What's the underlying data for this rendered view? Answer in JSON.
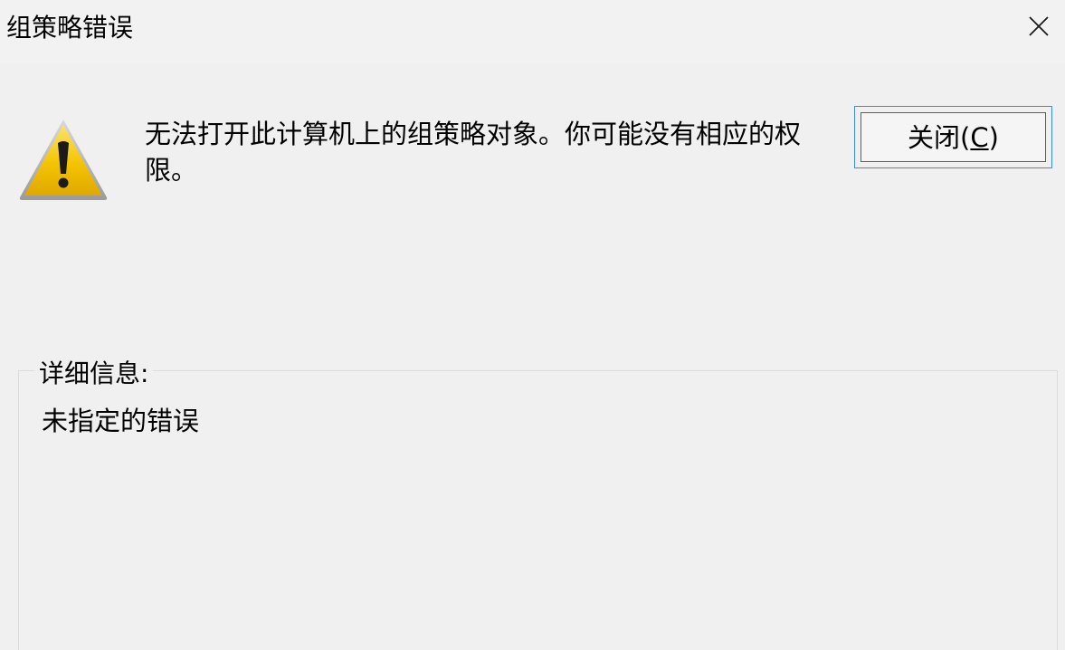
{
  "window": {
    "title": "组策略错误"
  },
  "dialog": {
    "message": "无法打开此计算机上的组策略对象。你可能没有相应的权限。",
    "close_button": {
      "label_prefix": "关闭(",
      "label_shortcut": "C",
      "label_suffix": ")"
    },
    "details": {
      "legend": "详细信息:",
      "text": "未指定的错误"
    }
  },
  "icons": {
    "warning": "warning-icon",
    "close": "close-icon"
  },
  "colors": {
    "background": "#f0f0f0",
    "button_focus_border": "#3c8be3",
    "warning_yellow": "#f5c400"
  }
}
